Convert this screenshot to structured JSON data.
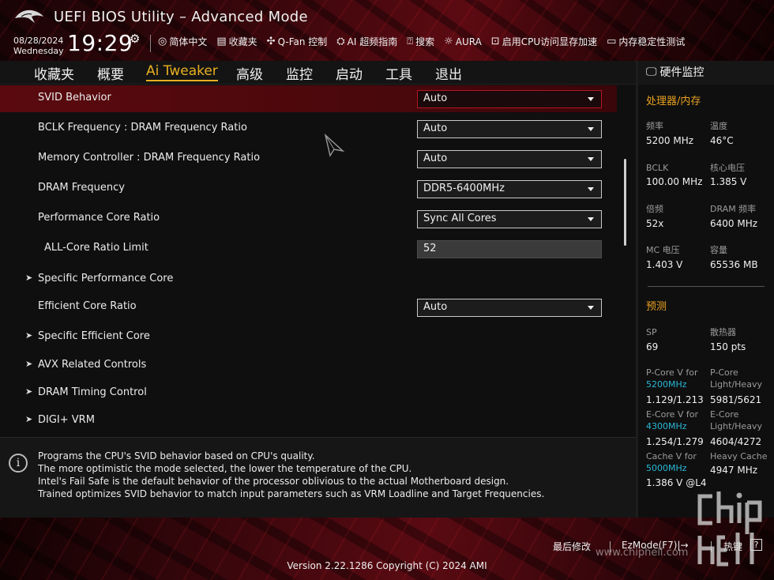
{
  "header": {
    "title": "UEFI BIOS Utility – Advanced Mode",
    "date": "08/28/2024",
    "weekday": "Wednesday",
    "time": "19:29",
    "toolbar": [
      {
        "icon": "globe-icon",
        "label": "简体中文"
      },
      {
        "icon": "favorites-icon",
        "label": "收藏夹"
      },
      {
        "icon": "fan-icon",
        "label": "Q-Fan 控制"
      },
      {
        "icon": "ai-icon",
        "label": "AI 超频指南"
      },
      {
        "icon": "search-icon",
        "label": "搜索"
      },
      {
        "icon": "aura-icon",
        "label": "AURA"
      },
      {
        "icon": "resizebar-icon",
        "label": "启用CPU访问显存加速"
      },
      {
        "icon": "memtest-icon",
        "label": "内存稳定性测试"
      }
    ]
  },
  "tabs": [
    {
      "label": "收藏夹",
      "active": false
    },
    {
      "label": "概要",
      "active": false
    },
    {
      "label": "Ai Tweaker",
      "active": true
    },
    {
      "label": "高级",
      "active": false
    },
    {
      "label": "监控",
      "active": false
    },
    {
      "label": "启动",
      "active": false
    },
    {
      "label": "工具",
      "active": false
    },
    {
      "label": "退出",
      "active": false
    }
  ],
  "settings": [
    {
      "label": "SVID Behavior",
      "value": "Auto",
      "control": "dropdown",
      "selected": true
    },
    {
      "label": "BCLK Frequency : DRAM Frequency Ratio",
      "value": "Auto",
      "control": "dropdown"
    },
    {
      "label": "Memory Controller : DRAM Frequency Ratio",
      "value": "Auto",
      "control": "dropdown"
    },
    {
      "label": "DRAM Frequency",
      "value": "DDR5-6400MHz",
      "control": "dropdown"
    },
    {
      "label": "Performance Core Ratio",
      "value": "Sync All Cores",
      "control": "dropdown"
    },
    {
      "label": "ALL-Core Ratio Limit",
      "value": "52",
      "control": "input"
    },
    {
      "label": "Specific Performance Core",
      "control": "submenu"
    },
    {
      "label": "Efficient Core Ratio",
      "value": "Auto",
      "control": "dropdown"
    },
    {
      "label": "Specific Efficient Core",
      "control": "submenu"
    },
    {
      "label": "AVX Related Controls",
      "control": "submenu"
    },
    {
      "label": "DRAM Timing Control",
      "control": "submenu"
    },
    {
      "label": "DIGI+ VRM",
      "control": "submenu"
    }
  ],
  "help": {
    "lines": [
      "Programs the CPU's SVID behavior based on CPU's quality.",
      "The more optimistic the mode selected, the lower the temperature of the CPU.",
      "Intel's Fail Safe is the default behavior of the processor oblivious to the actual Motherboard design.",
      "Trained optimizes SVID behavior to match input parameters such as VRM Loadline and Target Frequencies."
    ]
  },
  "monitor": {
    "title": "硬件监控",
    "cpu_mem_section": "处理器/内存",
    "cpu_mem": [
      {
        "label": "频率",
        "value": "5200 MHz"
      },
      {
        "label": "温度",
        "value": "46°C"
      },
      {
        "label": "BCLK",
        "value": "100.00 MHz"
      },
      {
        "label": "核心电压",
        "value": "1.385 V"
      },
      {
        "label": "倍频",
        "value": "52x"
      },
      {
        "label": "DRAM 频率",
        "value": "6400 MHz"
      },
      {
        "label": "MC 电压",
        "value": "1.403 V"
      },
      {
        "label": "容量",
        "value": "65536 MB"
      }
    ],
    "predict_section": "预测",
    "predict": [
      {
        "label": "SP",
        "value": "69"
      },
      {
        "label": "散热器",
        "value": "150 pts"
      }
    ],
    "predict_detail": [
      {
        "label": "P-Core V for",
        "freq": "5200MHz",
        "value": "1.129/1.213"
      },
      {
        "label": "P-Core",
        "label2": "Light/Heavy",
        "value": "5981/5621"
      },
      {
        "label": "E-Core V for",
        "freq": "4300MHz",
        "value": "1.254/1.279"
      },
      {
        "label": "E-Core",
        "label2": "Light/Heavy",
        "value": "4604/4272"
      },
      {
        "label": "Cache V for",
        "freq": "5000MHz",
        "value": "1.386 V @L4"
      },
      {
        "label": "Heavy Cache",
        "value": "4947 MHz"
      }
    ]
  },
  "footer": {
    "last_modified": "最后修改",
    "ezmode": "EzMode(F7)|→",
    "hotkeys": "热键",
    "hotkey_badge": "?",
    "version": "Version 2.22.1286 Copyright (C) 2024 AMI",
    "watermark_url": "www.chiphell.com"
  }
}
